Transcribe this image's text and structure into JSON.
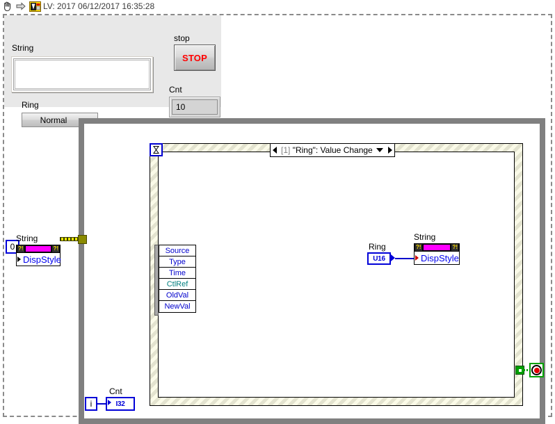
{
  "titlebar": {
    "text": "LV: 2017 06/12/2017 16:35:28",
    "icons": [
      "hand-icon",
      "arrow-right-icon",
      "labview-icon"
    ]
  },
  "front_panel": {
    "string_control": {
      "label": "String",
      "value": "",
      "placeholder": ""
    },
    "ring_control": {
      "label": "Ring",
      "value": "Normal",
      "options": [
        "Normal"
      ]
    },
    "stop_button": {
      "label": "stop",
      "text": "STOP",
      "color": "#ff0000"
    },
    "cnt_indicator": {
      "label": "Cnt",
      "value": "10"
    }
  },
  "block_diagram": {
    "while_loop": {
      "border_color": "#808080"
    },
    "left_property_node": {
      "title": "String",
      "property": "DispStyle",
      "accent_color": "#ff00ff",
      "glyph": "?!"
    },
    "constant_zero": {
      "value": "0"
    },
    "event_structure": {
      "selector": {
        "index": "[1]",
        "text": "\"Ring\": Value Change"
      },
      "timeout_terminal": "timeout-icon",
      "data_node": [
        {
          "label": "Source",
          "color": "#0000cc"
        },
        {
          "label": "Type",
          "color": "#0000cc"
        },
        {
          "label": "Time",
          "color": "#0000cc"
        },
        {
          "label": "CtlRef",
          "color": "#007f7f"
        },
        {
          "label": "OldVal",
          "color": "#0000cc"
        },
        {
          "label": "NewVal",
          "color": "#0000cc"
        }
      ]
    },
    "ring_terminal": {
      "label": "Ring",
      "type": "U16"
    },
    "right_property_node": {
      "title": "String",
      "property": "DispStyle",
      "accent_color": "#ff00ff",
      "glyph": "?!"
    },
    "iteration_terminal": {
      "label": "i"
    },
    "cnt_terminal": {
      "label": "Cnt",
      "type": "I32"
    },
    "stop_condition": {
      "name": "stop-sign-terminal",
      "color": "#e00000"
    }
  }
}
